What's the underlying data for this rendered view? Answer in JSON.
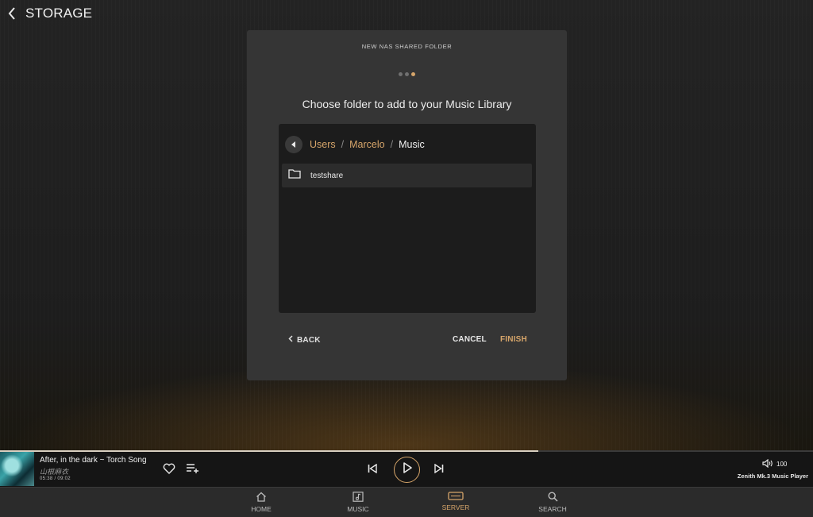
{
  "header": {
    "title": "STORAGE"
  },
  "dialog": {
    "caption": "NEW NAS SHARED FOLDER",
    "step_current": 3,
    "step_total": 3,
    "heading": "Choose folder to add to your Music Library",
    "breadcrumb": [
      "Users",
      "Marcelo",
      "Music"
    ],
    "breadcrumb_sep": "/",
    "folders": [
      "testshare"
    ],
    "back_label": "BACK",
    "cancel_label": "CANCEL",
    "finish_label": "FINISH"
  },
  "player": {
    "track_title": "After, in the dark ~ Torch Song",
    "artist": "山根麻衣",
    "elapsed": "05:38",
    "duration": "09:02",
    "time_display": "05:38 / 09:02",
    "progress_fraction": 0.662,
    "volume": "100",
    "device": "Zenith Mk.3 Music Player"
  },
  "nav": {
    "home": "HOME",
    "music": "MUSIC",
    "server": "SERVER",
    "search": "SEARCH",
    "active": "server"
  },
  "colors": {
    "accent": "#d6a56a",
    "dialog_bg": "#353535",
    "panel_bg": "#1c1c1c"
  },
  "icons": [
    "chevron-left-icon",
    "circle-back-icon",
    "folder-icon",
    "heart-icon",
    "add-to-queue-icon",
    "skip-previous-icon",
    "play-icon",
    "skip-next-icon",
    "volume-icon",
    "home-icon",
    "music-icon",
    "server-icon",
    "search-icon"
  ]
}
